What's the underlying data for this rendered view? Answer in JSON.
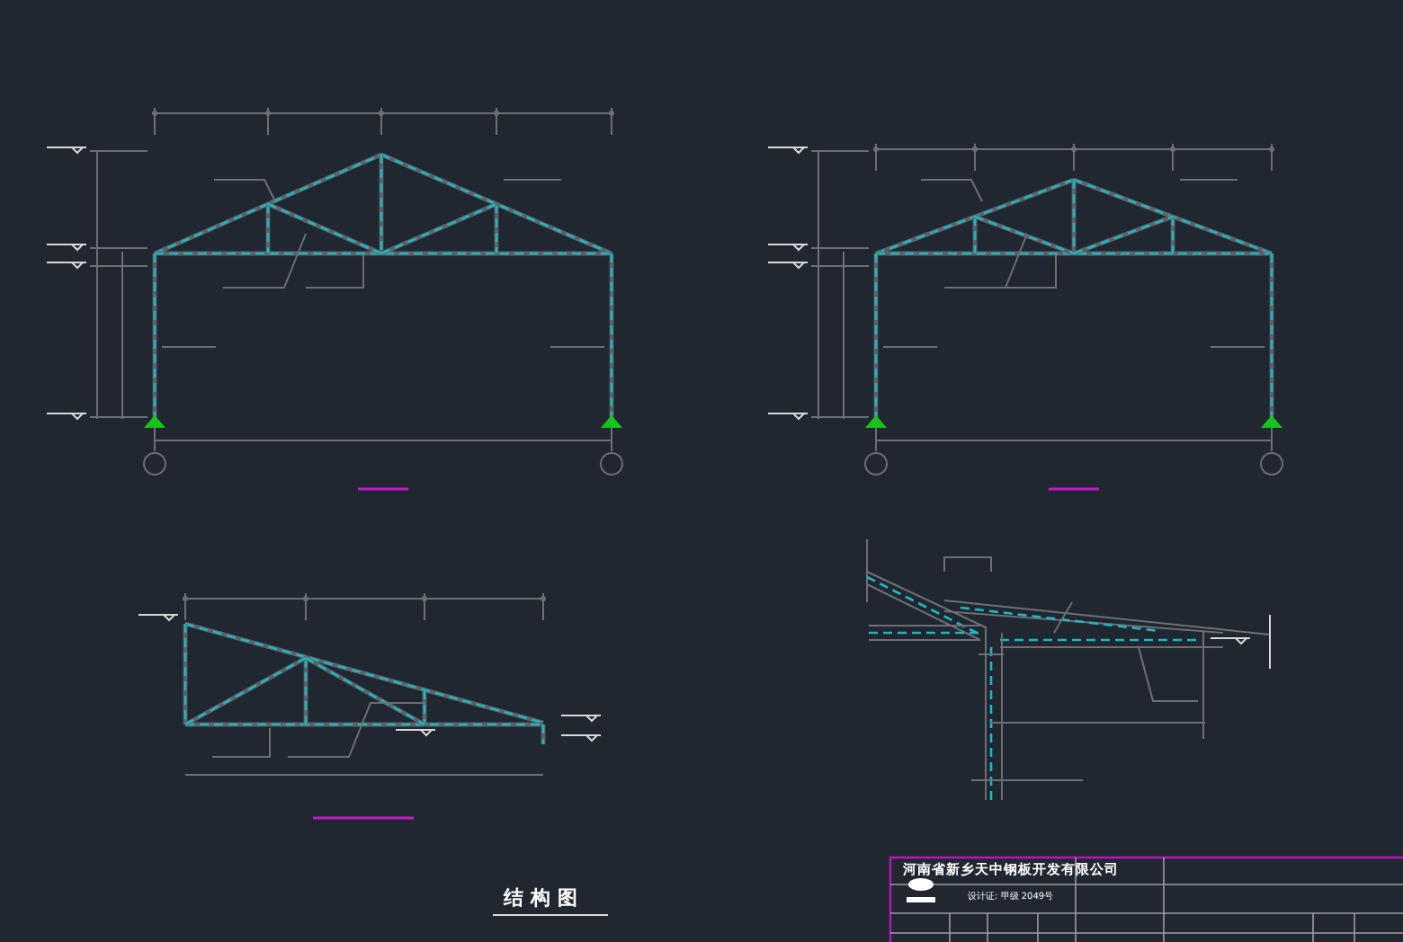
{
  "drawing_title": "结构图",
  "title_block": {
    "company": "河南省新乡天中钢板开发有限公司",
    "certificate": "设计证: 甲级 2049号"
  }
}
